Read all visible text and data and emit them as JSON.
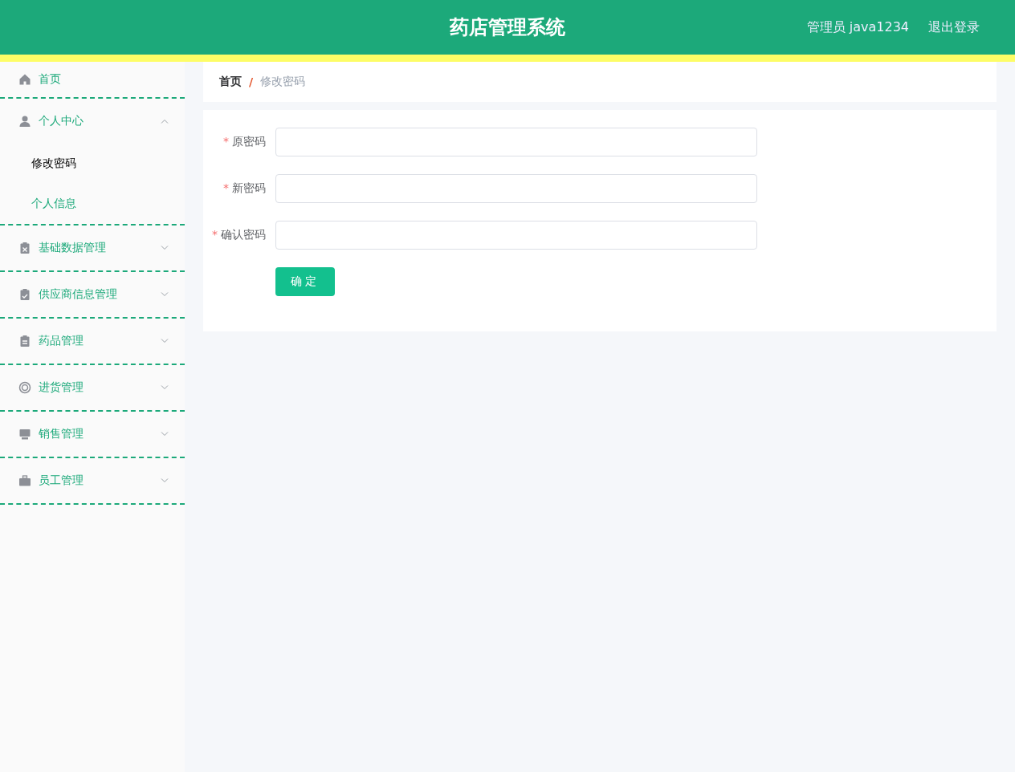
{
  "header": {
    "title": "药店管理系统",
    "user": "管理员 java1234",
    "logout": "退出登录"
  },
  "sidebar": {
    "items": [
      {
        "kind": "item",
        "label": "首页"
      },
      {
        "kind": "submenu",
        "label": "个人中心",
        "expanded": true,
        "children": [
          {
            "label": "修改密码",
            "selected": true
          },
          {
            "label": "个人信息",
            "selected": false
          }
        ]
      },
      {
        "kind": "submenu",
        "label": "基础数据管理",
        "expanded": false
      },
      {
        "kind": "submenu",
        "label": "供应商信息管理",
        "expanded": false
      },
      {
        "kind": "submenu",
        "label": "药品管理",
        "expanded": false
      },
      {
        "kind": "submenu",
        "label": "进货管理",
        "expanded": false
      },
      {
        "kind": "submenu",
        "label": "销售管理",
        "expanded": false
      },
      {
        "kind": "submenu",
        "label": "员工管理",
        "expanded": false
      }
    ]
  },
  "breadcrumb": {
    "items": [
      "首页",
      "修改密码"
    ],
    "separator": "/"
  },
  "form": {
    "fields": [
      {
        "label": "原密码",
        "required": true,
        "required_mark": "*"
      },
      {
        "label": "新密码",
        "required": true,
        "required_mark": "*"
      },
      {
        "label": "确认密码",
        "required": true,
        "required_mark": "*"
      }
    ],
    "submit": "确定"
  }
}
